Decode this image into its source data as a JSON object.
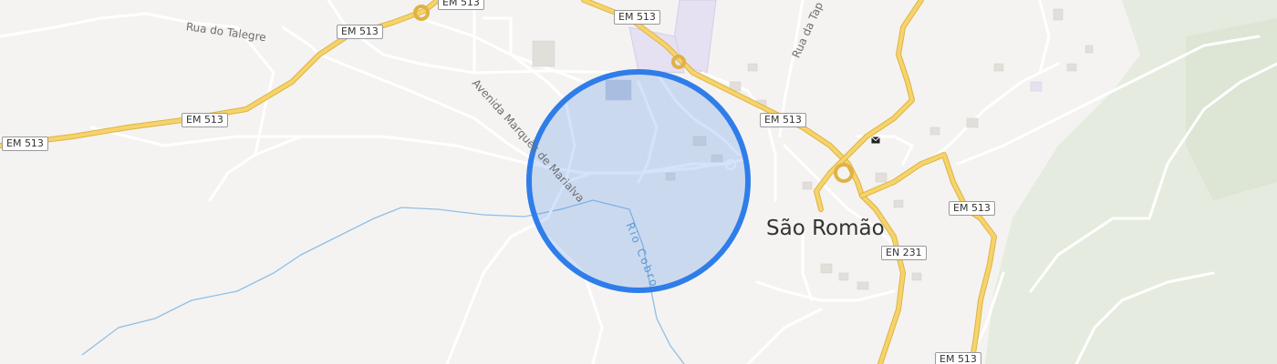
{
  "map": {
    "place_name": "São Romão",
    "road_shields": [
      "EM 513",
      "EM 513",
      "EM 513",
      "EM 513",
      "EM 513",
      "EM 513",
      "EM 513",
      "EN 231"
    ],
    "streets": [
      "Rua do Talegre",
      "Avenida Marquês de Marialva",
      "Rua da Tap"
    ],
    "river": "Rio Cobro",
    "colors": {
      "background": "#f4f3f1",
      "major_road": "#f2cc5c",
      "minor_road": "#ffffff",
      "water": "#8fbfe8",
      "forest": "#e3eadc",
      "school_area": "#e6e0f3",
      "location_fill": "#3d7fe6",
      "location_stroke": "#2f7de9"
    },
    "icons": [
      "envelope-icon"
    ]
  }
}
